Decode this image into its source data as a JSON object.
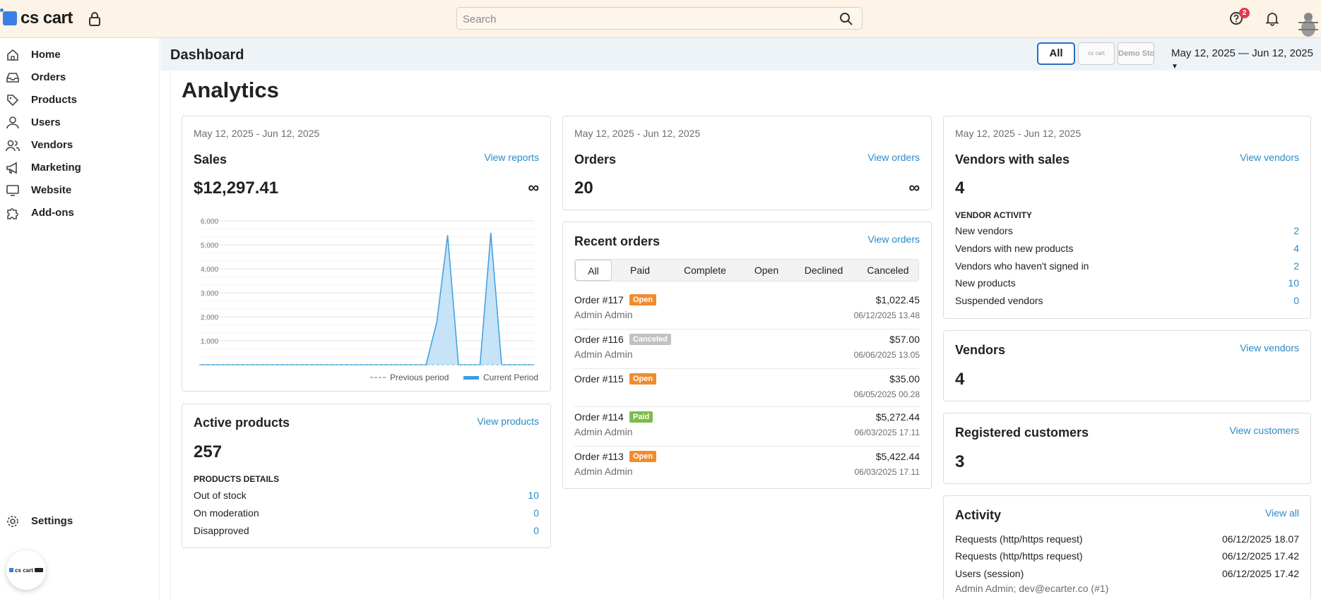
{
  "topbar": {
    "logo_text": "cs cart",
    "search_placeholder": "Search",
    "notifications_count": "2"
  },
  "sidebar": {
    "items": [
      {
        "label": "Home",
        "icon": "home-icon"
      },
      {
        "label": "Orders",
        "icon": "inbox-icon"
      },
      {
        "label": "Products",
        "icon": "tag-icon"
      },
      {
        "label": "Users",
        "icon": "user-icon"
      },
      {
        "label": "Vendors",
        "icon": "users-icon"
      },
      {
        "label": "Marketing",
        "icon": "megaphone-icon"
      },
      {
        "label": "Website",
        "icon": "monitor-icon"
      },
      {
        "label": "Add-ons",
        "icon": "puzzle-icon"
      }
    ],
    "settings_label": "Settings",
    "mini_logo_text": "cs cart"
  },
  "header": {
    "page_title": "Dashboard",
    "store_all": "All",
    "store_1": "cs cart",
    "store_2": "Demo Store",
    "date_range": "May 12, 2025 — Jun 12, 2025"
  },
  "main": {
    "title": "Analytics"
  },
  "sales": {
    "date": "May 12, 2025 - Jun 12, 2025",
    "title": "Sales",
    "link": "View reports",
    "value": "$12,297.41",
    "infinity": "∞"
  },
  "chart_data": {
    "type": "area",
    "ylim": [
      0,
      6000
    ],
    "yticks": [
      "6,000",
      "5,000",
      "4,000",
      "3,000",
      "2,000",
      "1,000"
    ],
    "series": [
      {
        "name": "Previous period",
        "values": [
          0,
          0,
          0,
          0,
          0,
          0,
          0,
          0,
          0,
          0,
          0,
          0,
          0,
          0,
          0,
          0,
          0,
          0,
          0,
          0,
          0,
          0,
          0,
          0,
          0,
          0,
          0,
          0,
          0,
          0,
          0,
          0
        ]
      },
      {
        "name": "Current Period",
        "values": [
          0,
          0,
          0,
          0,
          0,
          0,
          0,
          0,
          0,
          0,
          0,
          0,
          0,
          0,
          0,
          0,
          0,
          0,
          0,
          0,
          0,
          0,
          1800,
          5400,
          0,
          0,
          0,
          5500,
          0,
          0,
          0,
          0
        ]
      }
    ]
  },
  "orders_card": {
    "date": "May 12, 2025 - Jun 12, 2025",
    "title": "Orders",
    "link": "View orders",
    "value": "20",
    "infinity": "∞"
  },
  "recent_orders": {
    "title": "Recent orders",
    "link": "View orders",
    "tabs": [
      "All",
      "Paid",
      "Complete",
      "Open",
      "Declined",
      "Canceled"
    ],
    "orders": [
      {
        "num": "Order #117",
        "status": "Open",
        "customer": "Admin Admin",
        "amount": "$1,022.45",
        "date": "06/12/2025 13.48"
      },
      {
        "num": "Order #116",
        "status": "Canceled",
        "customer": "Admin Admin",
        "amount": "$57.00",
        "date": "06/06/2025 13.05"
      },
      {
        "num": "Order #115",
        "status": "Open",
        "customer": "",
        "amount": "$35.00",
        "date": "06/05/2025 00.28"
      },
      {
        "num": "Order #114",
        "status": "Paid",
        "customer": "Admin Admin",
        "amount": "$5,272.44",
        "date": "06/03/2025 17.11"
      },
      {
        "num": "Order #113",
        "status": "Open",
        "customer": "Admin Admin",
        "amount": "$5,422.44",
        "date": "06/03/2025 17.11"
      }
    ],
    "status_colors": {
      "Open": "#f08c2e",
      "Canceled": "#c2c2c2",
      "Paid": "#7cbc4a"
    }
  },
  "active_products": {
    "title": "Active products",
    "link": "View products",
    "value": "257",
    "section": "PRODUCTS DETAILS",
    "rows": [
      {
        "label": "Out of stock",
        "value": "10"
      },
      {
        "label": "On moderation",
        "value": "0"
      },
      {
        "label": "Disapproved",
        "value": "0"
      }
    ]
  },
  "vendors_sales": {
    "date": "May 12, 2025 - Jun 12, 2025",
    "title": "Vendors with sales",
    "link": "View vendors",
    "value": "4",
    "section": "VENDOR ACTIVITY",
    "rows": [
      {
        "label": "New vendors",
        "value": "2"
      },
      {
        "label": "Vendors with new products",
        "value": "4"
      },
      {
        "label": "Vendors who haven't signed in",
        "value": "2"
      },
      {
        "label": "New products",
        "value": "10"
      },
      {
        "label": "Suspended vendors",
        "value": "0"
      }
    ]
  },
  "vendors": {
    "title": "Vendors",
    "link": "View vendors",
    "value": "4"
  },
  "customers": {
    "title": "Registered customers",
    "link": "View customers",
    "value": "3"
  },
  "activity": {
    "title": "Activity",
    "link": "View all",
    "rows": [
      {
        "label": "Requests (http/https request)",
        "date": "06/12/2025 18.07"
      },
      {
        "label": "Requests (http/https request)",
        "date": "06/12/2025 17.42"
      },
      {
        "label": "Users (session)",
        "date": "06/12/2025 17.42"
      }
    ],
    "sub": "Admin Admin; dev@ecarter.co (#1)"
  }
}
